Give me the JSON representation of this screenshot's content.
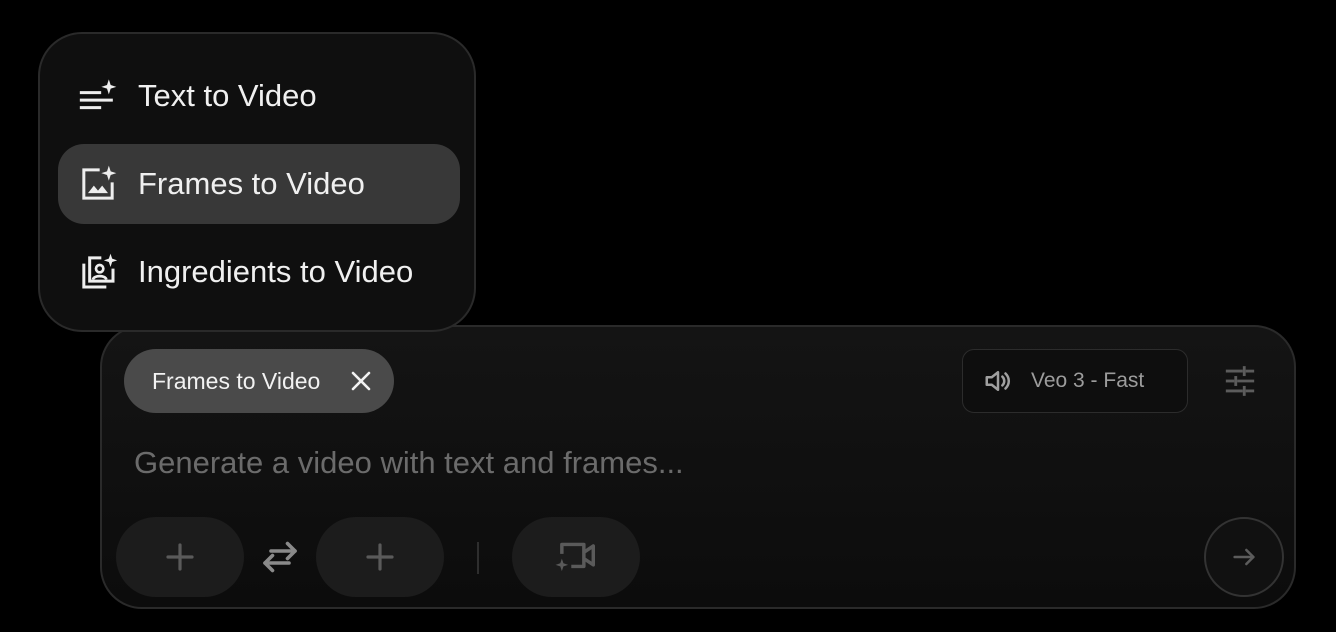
{
  "menu": {
    "items": [
      {
        "label": "Text to Video",
        "icon": "text-sparkle-icon",
        "selected": false
      },
      {
        "label": "Frames to Video",
        "icon": "image-sparkle-icon",
        "selected": true
      },
      {
        "label": "Ingredients to Video",
        "icon": "portrait-stack-sparkle-icon",
        "selected": false
      }
    ]
  },
  "composer": {
    "mode_chip_label": "Frames to Video",
    "model_label": "Veo 3 - Fast",
    "prompt_placeholder": "Generate a video with text and frames...",
    "prompt_value": ""
  },
  "icons": {
    "chip_close": "close-icon",
    "model": "speaker-icon",
    "settings": "tune-sliders-icon",
    "start_frame": "plus-icon",
    "swap": "swap-arrows-icon",
    "end_frame": "plus-icon",
    "camera": "video-sparkle-icon",
    "send": "arrow-right-icon"
  },
  "colors": {
    "background": "#000000",
    "panel": "#0f0f0f",
    "selected_item": "#383838",
    "chip": "#4a4a4a",
    "placeholder": "#6b6b6b",
    "muted_icon": "#5a5a5a"
  }
}
